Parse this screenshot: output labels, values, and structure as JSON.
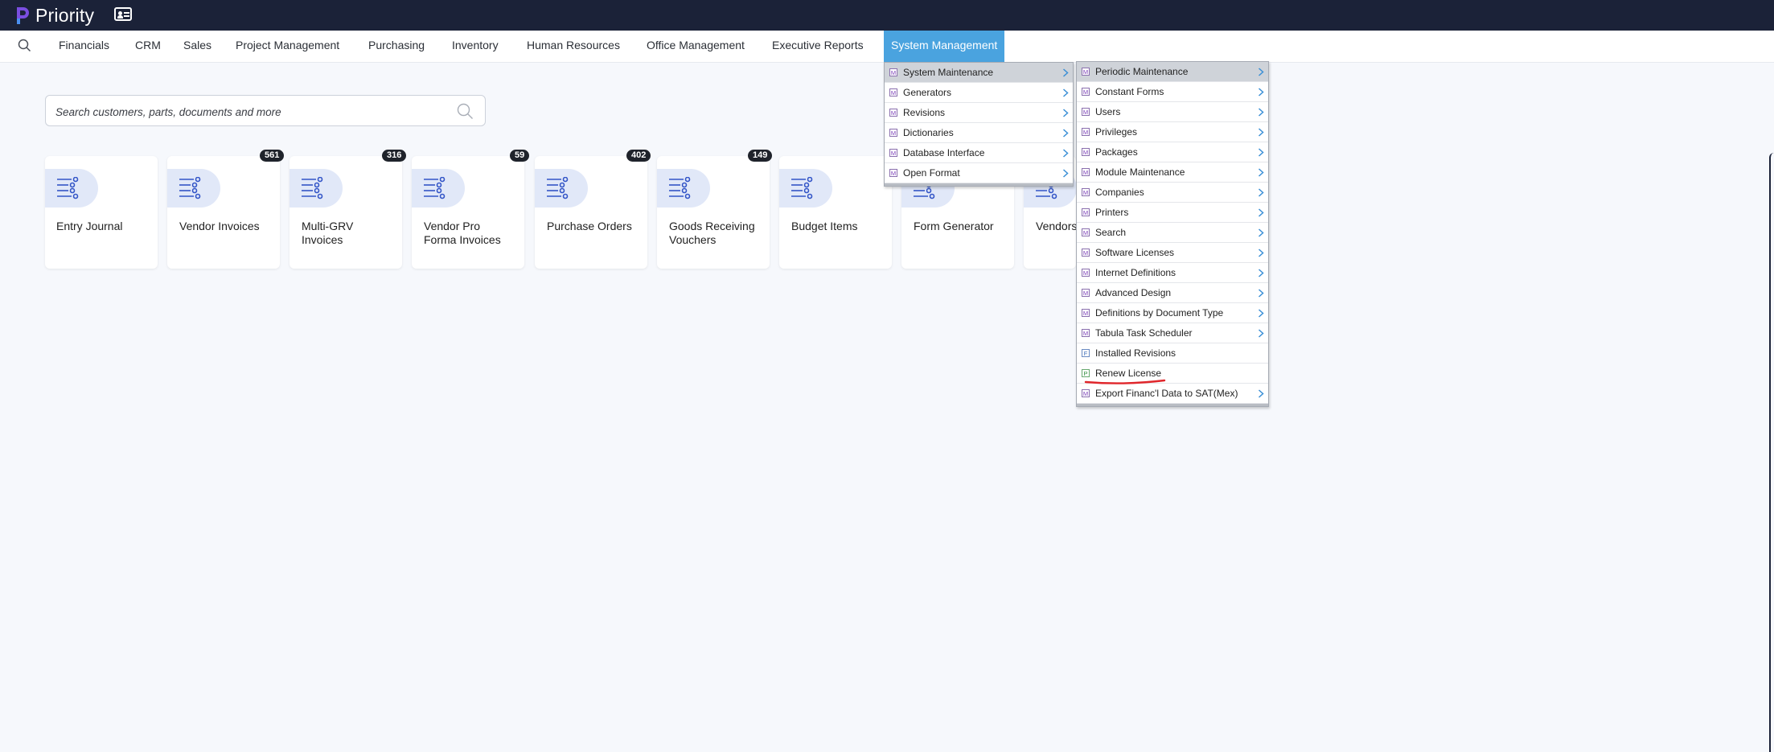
{
  "app": {
    "name": "Priority",
    "brand_color": "#1b2238",
    "accent": "#4aa3df"
  },
  "topbar": {
    "icons": [
      "priority-logo",
      "id-card-icon"
    ]
  },
  "menubar": {
    "search_icon": "search-icon",
    "items": [
      {
        "label": "Financials"
      },
      {
        "label": "CRM"
      },
      {
        "label": "Sales"
      },
      {
        "label": "Project Management"
      },
      {
        "label": "Purchasing"
      },
      {
        "label": "Inventory"
      },
      {
        "label": "Human Resources"
      },
      {
        "label": "Office Management"
      },
      {
        "label": "Executive Reports"
      },
      {
        "label": "System Management",
        "active": true
      }
    ]
  },
  "search": {
    "placeholder": "Search customers, parts, documents and more",
    "value": ""
  },
  "cards": [
    {
      "label": "Entry Journal",
      "badge": ""
    },
    {
      "label": "Vendor Invoices",
      "badge": "561"
    },
    {
      "label": "Multi-GRV Invoices",
      "badge": "316"
    },
    {
      "label": "Vendor Pro Forma Invoices",
      "badge": "59"
    },
    {
      "label": "Purchase Orders",
      "badge": "402"
    },
    {
      "label": "Goods Receiving Vouchers",
      "badge": "149"
    },
    {
      "label": "Budget Items",
      "badge": ""
    },
    {
      "label": "Form Generator",
      "badge": ""
    },
    {
      "label": "Vendors",
      "badge": ""
    }
  ],
  "submenu1": {
    "items": [
      {
        "tag": "M",
        "label": "System Maintenance",
        "submenu": true,
        "highlighted": true
      },
      {
        "tag": "M",
        "label": "Generators",
        "submenu": true
      },
      {
        "tag": "M",
        "label": "Revisions",
        "submenu": true
      },
      {
        "tag": "M",
        "label": "Dictionaries",
        "submenu": true
      },
      {
        "tag": "M",
        "label": "Database Interface",
        "submenu": true
      },
      {
        "tag": "M",
        "label": "Open Format",
        "submenu": true
      }
    ]
  },
  "submenu2": {
    "items": [
      {
        "tag": "M",
        "label": "Periodic Maintenance",
        "submenu": true,
        "highlighted": true
      },
      {
        "tag": "M",
        "label": "Constant Forms",
        "submenu": true
      },
      {
        "tag": "M",
        "label": "Users",
        "submenu": true
      },
      {
        "tag": "M",
        "label": "Privileges",
        "submenu": true
      },
      {
        "tag": "M",
        "label": "Packages",
        "submenu": true
      },
      {
        "tag": "M",
        "label": "Module Maintenance",
        "submenu": true
      },
      {
        "tag": "M",
        "label": "Companies",
        "submenu": true
      },
      {
        "tag": "M",
        "label": "Printers",
        "submenu": true
      },
      {
        "tag": "M",
        "label": "Search",
        "submenu": true
      },
      {
        "tag": "M",
        "label": "Software Licenses",
        "submenu": true
      },
      {
        "tag": "M",
        "label": "Internet Definitions",
        "submenu": true
      },
      {
        "tag": "M",
        "label": "Advanced Design",
        "submenu": true
      },
      {
        "tag": "M",
        "label": "Definitions by Document Type",
        "submenu": true
      },
      {
        "tag": "M",
        "label": "Tabula Task Scheduler",
        "submenu": true
      },
      {
        "tag": "F",
        "label": "Installed Revisions",
        "submenu": false
      },
      {
        "tag": "P",
        "label": "Renew License",
        "submenu": false,
        "annotated": true
      },
      {
        "tag": "M",
        "label": "Export Financ'l Data to SAT(Mex)",
        "submenu": true
      }
    ]
  }
}
